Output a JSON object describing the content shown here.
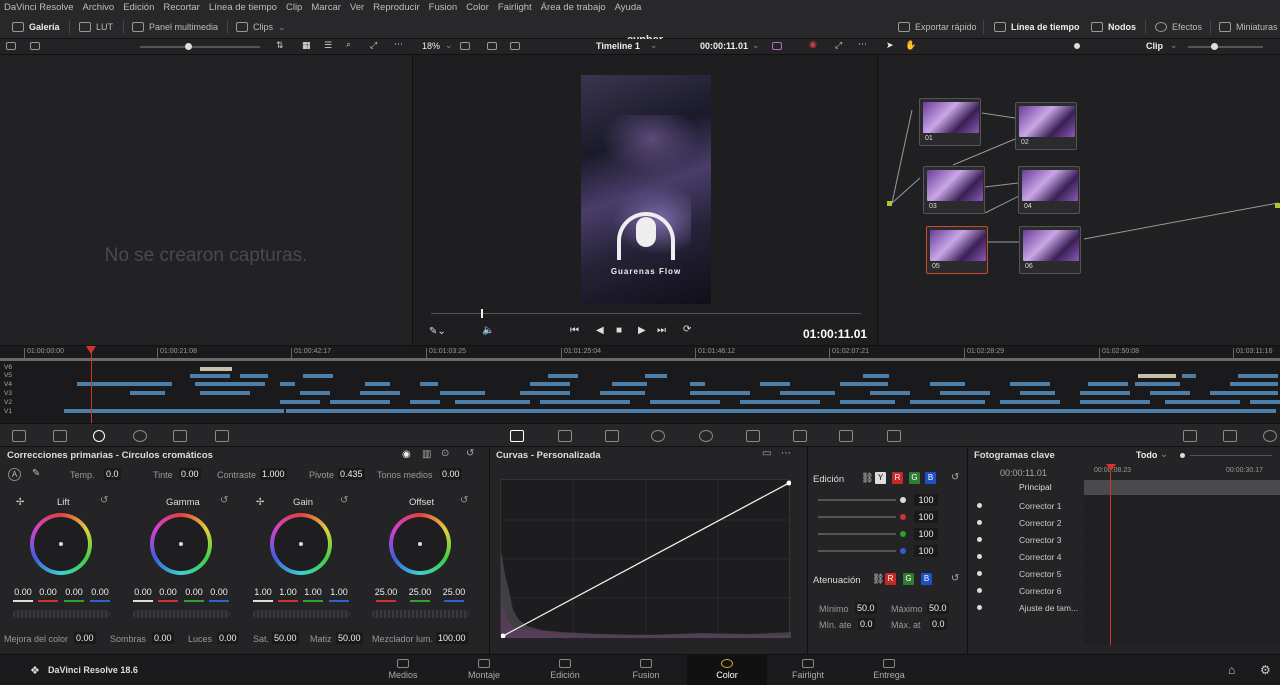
{
  "menu": [
    "DaVinci Resolve",
    "Archivo",
    "Edición",
    "Recortar",
    "Línea de tiempo",
    "Clip",
    "Marcar",
    "Ver",
    "Reproducir",
    "Fusion",
    "Color",
    "Fairlight",
    "Área de trabajo",
    "Ayuda"
  ],
  "app_title": "cypher",
  "toolbar": {
    "gallery": "Galería",
    "lut": "LUT",
    "media_panel": "Panel multimedia",
    "clips": "Clips",
    "quick_export": "Exportar rápido",
    "timeline": "Línea de tiempo",
    "nodes": "Nodos",
    "effects": "Efectos",
    "thumbnails": "Miniaturas"
  },
  "viewer": {
    "zoom": "18%",
    "timeline_name": "Timeline 1",
    "timecode_top": "00:00:11.01",
    "timecode": "01:00:11.01",
    "overlay_text": "Guarenas Flow",
    "clip_mode": "Clip"
  },
  "gallery": {
    "empty_message": "No se crearon capturas."
  },
  "nodes": [
    {
      "label": "01"
    },
    {
      "label": "02"
    },
    {
      "label": "03"
    },
    {
      "label": "04"
    },
    {
      "label": "05"
    },
    {
      "label": "06"
    }
  ],
  "timeline": {
    "ruler": [
      "01:00:00:00",
      "01:00:21:08",
      "01:00:42:17",
      "01:01:03:25",
      "01:01:25:04",
      "01:01:46:12",
      "01:02:07:21",
      "01:02:28:29",
      "01:02:50:08",
      "01:03:11:16"
    ],
    "tracks": [
      "V6",
      "V5",
      "V4",
      "V3",
      "V2",
      "V1"
    ]
  },
  "primaries": {
    "title": "Correcciones primarias - Círculos cromáticos",
    "temp_label": "Temp.",
    "temp": "0.0",
    "tint_label": "Tinte",
    "tint": "0.00",
    "contrast_label": "Contraste",
    "contrast": "1.000",
    "pivot_label": "Pivote",
    "pivot": "0.435",
    "midtones_label": "Tonos medios",
    "midtones": "0.00",
    "wheels": [
      {
        "name": "Lift",
        "values": [
          "0.00",
          "0.00",
          "0.00",
          "0.00"
        ]
      },
      {
        "name": "Gamma",
        "values": [
          "0.00",
          "0.00",
          "0.00",
          "0.00"
        ]
      },
      {
        "name": "Gain",
        "values": [
          "1.00",
          "1.00",
          "1.00",
          "1.00"
        ]
      },
      {
        "name": "Offset",
        "values": [
          "25.00",
          "25.00",
          "25.00"
        ]
      }
    ],
    "bottom": [
      {
        "label": "Mejora del color",
        "value": "0.00"
      },
      {
        "label": "Sombras",
        "value": "0.00"
      },
      {
        "label": "Luces",
        "value": "0.00"
      },
      {
        "label": "Sat.",
        "value": "50.00"
      },
      {
        "label": "Matiz",
        "value": "50.00"
      },
      {
        "label": "Mezclador lum.",
        "value": "100.00"
      }
    ]
  },
  "curves": {
    "title": "Curvas - Personalizada"
  },
  "edit": {
    "title": "Edición",
    "chips": [
      "Y",
      "R",
      "G",
      "B"
    ],
    "values": [
      "100",
      "100",
      "100",
      "100"
    ],
    "attenuation": "Atenuación",
    "min_label": "Mínimo",
    "min": "50.0",
    "max_label": "Máximo",
    "max": "50.0",
    "min_att_label": "Mín. ate",
    "min_att": "0.0",
    "max_att_label": "Máx. at",
    "max_att": "0.0"
  },
  "keyframes": {
    "title": "Fotogramas clave",
    "filter": "Todo",
    "time": "00:00:11.01",
    "tc_left": "00:00:08.23",
    "tc_right": "00:00:30.17",
    "main": "Principal",
    "rows": [
      "Corrector 1",
      "Corrector 2",
      "Corrector 3",
      "Corrector 4",
      "Corrector 5",
      "Corrector 6",
      "Ajuste de tam..."
    ]
  },
  "pages": {
    "brand": "DaVinci Resolve 18.6",
    "items": [
      "Medios",
      "Montaje",
      "Edición",
      "Fusion",
      "Color",
      "Fairlight",
      "Entrega"
    ],
    "active": "Color"
  },
  "colors": {
    "accent_red": "#d2332a",
    "clip_blue": "#4c7ea8"
  }
}
